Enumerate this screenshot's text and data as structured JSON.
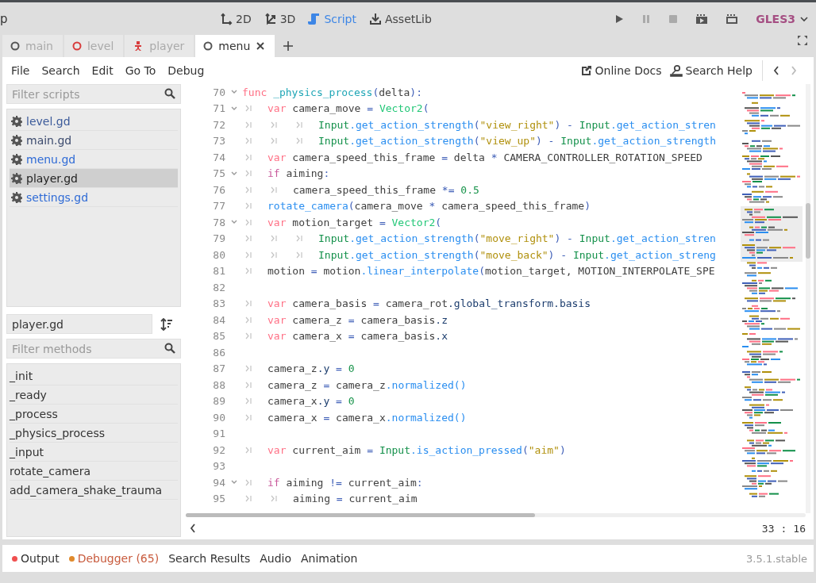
{
  "title_fragment": "p",
  "workspaces": [
    {
      "label": "2D",
      "kind": "flat",
      "selected": false
    },
    {
      "label": "3D",
      "kind": "spatial",
      "selected": false
    },
    {
      "label": "Script",
      "kind": "script",
      "selected": true
    },
    {
      "label": "AssetLib",
      "kind": "assetlib",
      "selected": false
    }
  ],
  "renderer": "GLES3",
  "scene_tabs": [
    {
      "label": "main",
      "kind": "node",
      "selected": false
    },
    {
      "label": "level",
      "kind": "alert",
      "selected": false
    },
    {
      "label": "player",
      "kind": "figure",
      "selected": false
    },
    {
      "label": "menu",
      "kind": "node",
      "selected": true
    }
  ],
  "menu": [
    "File",
    "Search",
    "Edit",
    "Go To",
    "Debug"
  ],
  "help_links": [
    {
      "label": "Online Docs",
      "kind": "external"
    },
    {
      "label": "Search Help",
      "kind": "docsearch"
    }
  ],
  "script_filter": {
    "placeholder": "Filter scripts"
  },
  "scripts": [
    {
      "name": "level.gd",
      "color": "#3b5a9a",
      "selected": false
    },
    {
      "name": "main.gd",
      "color": "#3c4b6e",
      "selected": false
    },
    {
      "name": "menu.gd",
      "color": "#2f6bd6",
      "selected": false
    },
    {
      "name": "player.gd",
      "color": "#1e1e1e",
      "selected": true
    },
    {
      "name": "settings.gd",
      "color": "#2f6bd6",
      "selected": false
    }
  ],
  "current_script": "player.gd",
  "method_filter": {
    "placeholder": "Filter methods"
  },
  "methods": [
    "_init",
    "_ready",
    "_process",
    "_physics_process",
    "_input",
    "rotate_camera",
    "add_camera_shake_trauma"
  ],
  "code": [
    {
      "n": "70",
      "fold": true,
      "tokens": [
        {
          "kind": "kw",
          "t": "func "
        },
        {
          "kind": "fn",
          "t": "_physics_process"
        },
        {
          "kind": "sym",
          "t": "("
        },
        {
          "kind": "txt",
          "t": "delta"
        },
        {
          "kind": "sym",
          "t": "):"
        }
      ]
    },
    {
      "n": "71",
      "fold": true,
      "tokens": [
        {
          "kind": "tab"
        },
        {
          "kind": "kw",
          "t": "var"
        },
        {
          "kind": "txt",
          "t": " camera_move"
        },
        {
          "kind": "sym",
          "t": " = "
        },
        {
          "kind": "ty",
          "t": "Vector2"
        },
        {
          "kind": "sym",
          "t": "("
        }
      ]
    },
    {
      "n": "72",
      "fold": false,
      "tokens": [
        {
          "kind": "tab"
        },
        {
          "kind": "tab"
        },
        {
          "kind": "tab"
        },
        {
          "kind": "cls",
          "t": "Input"
        },
        {
          "kind": "call",
          "t": ".get_action_strength"
        },
        {
          "kind": "sym",
          "t": "("
        },
        {
          "kind": "str",
          "t": "\"view_right\""
        },
        {
          "kind": "sym",
          "t": ") - "
        },
        {
          "kind": "cls",
          "t": "Input"
        },
        {
          "kind": "call",
          "t": ".get_action_stren"
        }
      ]
    },
    {
      "n": "73",
      "fold": false,
      "tokens": [
        {
          "kind": "tab"
        },
        {
          "kind": "tab"
        },
        {
          "kind": "tab"
        },
        {
          "kind": "cls",
          "t": "Input"
        },
        {
          "kind": "call",
          "t": ".get_action_strength"
        },
        {
          "kind": "sym",
          "t": "("
        },
        {
          "kind": "str",
          "t": "\"view_up\""
        },
        {
          "kind": "sym",
          "t": ") - "
        },
        {
          "kind": "cls",
          "t": "Input"
        },
        {
          "kind": "call",
          "t": ".get_action_strength"
        }
      ]
    },
    {
      "n": "74",
      "fold": false,
      "tokens": [
        {
          "kind": "tab"
        },
        {
          "kind": "kw",
          "t": "var"
        },
        {
          "kind": "txt",
          "t": " camera_speed_this_frame"
        },
        {
          "kind": "sym",
          "t": " = "
        },
        {
          "kind": "txt",
          "t": "delta"
        },
        {
          "kind": "sym",
          "t": " * "
        },
        {
          "kind": "txt",
          "t": "CAMERA_CONTROLLER_ROTATION_SPEED"
        }
      ]
    },
    {
      "n": "75",
      "fold": true,
      "tokens": [
        {
          "kind": "tab"
        },
        {
          "kind": "ctrl",
          "t": "if"
        },
        {
          "kind": "txt",
          "t": " aiming"
        },
        {
          "kind": "sym",
          "t": ":"
        }
      ]
    },
    {
      "n": "76",
      "fold": false,
      "tokens": [
        {
          "kind": "tab"
        },
        {
          "kind": "tab"
        },
        {
          "kind": "txt",
          "t": "camera_speed_this_frame"
        },
        {
          "kind": "sym",
          "t": " *= "
        },
        {
          "kind": "num",
          "t": "0.5"
        }
      ]
    },
    {
      "n": "77",
      "fold": false,
      "tokens": [
        {
          "kind": "tab"
        },
        {
          "kind": "call",
          "t": "rotate_camera"
        },
        {
          "kind": "sym",
          "t": "("
        },
        {
          "kind": "txt",
          "t": "camera_move"
        },
        {
          "kind": "sym",
          "t": " * "
        },
        {
          "kind": "txt",
          "t": "camera_speed_this_frame"
        },
        {
          "kind": "sym",
          "t": ")"
        }
      ]
    },
    {
      "n": "78",
      "fold": true,
      "tokens": [
        {
          "kind": "tab"
        },
        {
          "kind": "kw",
          "t": "var"
        },
        {
          "kind": "txt",
          "t": " motion_target"
        },
        {
          "kind": "sym",
          "t": " = "
        },
        {
          "kind": "ty",
          "t": "Vector2"
        },
        {
          "kind": "sym",
          "t": "("
        }
      ]
    },
    {
      "n": "79",
      "fold": false,
      "tokens": [
        {
          "kind": "tab"
        },
        {
          "kind": "tab"
        },
        {
          "kind": "tab"
        },
        {
          "kind": "cls",
          "t": "Input"
        },
        {
          "kind": "call",
          "t": ".get_action_strength"
        },
        {
          "kind": "sym",
          "t": "("
        },
        {
          "kind": "str",
          "t": "\"move_right\""
        },
        {
          "kind": "sym",
          "t": ") - "
        },
        {
          "kind": "cls",
          "t": "Input"
        },
        {
          "kind": "call",
          "t": ".get_action_stren"
        }
      ]
    },
    {
      "n": "80",
      "fold": false,
      "tokens": [
        {
          "kind": "tab"
        },
        {
          "kind": "tab"
        },
        {
          "kind": "tab"
        },
        {
          "kind": "cls",
          "t": "Input"
        },
        {
          "kind": "call",
          "t": ".get_action_strength"
        },
        {
          "kind": "sym",
          "t": "("
        },
        {
          "kind": "str",
          "t": "\"move_back\""
        },
        {
          "kind": "sym",
          "t": ") - "
        },
        {
          "kind": "cls",
          "t": "Input"
        },
        {
          "kind": "call",
          "t": ".get_action_streng"
        }
      ]
    },
    {
      "n": "81",
      "fold": false,
      "tokens": [
        {
          "kind": "tab"
        },
        {
          "kind": "txt",
          "t": "motion"
        },
        {
          "kind": "sym",
          "t": " = "
        },
        {
          "kind": "txt",
          "t": "motion"
        },
        {
          "kind": "call",
          "t": ".linear_interpolate"
        },
        {
          "kind": "sym",
          "t": "("
        },
        {
          "kind": "txt",
          "t": "motion_target, MOTION_INTERPOLATE_SPE"
        }
      ]
    },
    {
      "n": "82",
      "fold": false
    },
    {
      "n": "83",
      "fold": false,
      "tokens": [
        {
          "kind": "tab"
        },
        {
          "kind": "kw",
          "t": "var"
        },
        {
          "kind": "txt",
          "t": " camera_basis"
        },
        {
          "kind": "sym",
          "t": " = "
        },
        {
          "kind": "txt",
          "t": "camera_rot"
        },
        {
          "kind": "prop",
          "t": ".global_transform.basis"
        }
      ]
    },
    {
      "n": "84",
      "fold": false,
      "tokens": [
        {
          "kind": "tab"
        },
        {
          "kind": "kw",
          "t": "var"
        },
        {
          "kind": "txt",
          "t": " camera_z"
        },
        {
          "kind": "sym",
          "t": " = "
        },
        {
          "kind": "txt",
          "t": "camera_basis"
        },
        {
          "kind": "prop",
          "t": ".z"
        }
      ]
    },
    {
      "n": "85",
      "fold": false,
      "tokens": [
        {
          "kind": "tab"
        },
        {
          "kind": "kw",
          "t": "var"
        },
        {
          "kind": "txt",
          "t": " camera_x"
        },
        {
          "kind": "sym",
          "t": " = "
        },
        {
          "kind": "txt",
          "t": "camera_basis"
        },
        {
          "kind": "prop",
          "t": ".x"
        }
      ]
    },
    {
      "n": "86",
      "fold": false
    },
    {
      "n": "87",
      "fold": false,
      "tokens": [
        {
          "kind": "tab"
        },
        {
          "kind": "txt",
          "t": "camera_z"
        },
        {
          "kind": "prop",
          "t": ".y"
        },
        {
          "kind": "sym",
          "t": " = "
        },
        {
          "kind": "num",
          "t": "0"
        }
      ]
    },
    {
      "n": "88",
      "fold": false,
      "tokens": [
        {
          "kind": "tab"
        },
        {
          "kind": "txt",
          "t": "camera_z"
        },
        {
          "kind": "sym",
          "t": " = "
        },
        {
          "kind": "txt",
          "t": "camera_z"
        },
        {
          "kind": "call",
          "t": ".normalized()"
        }
      ]
    },
    {
      "n": "89",
      "fold": false,
      "tokens": [
        {
          "kind": "tab"
        },
        {
          "kind": "txt",
          "t": "camera_x"
        },
        {
          "kind": "prop",
          "t": ".y"
        },
        {
          "kind": "sym",
          "t": " = "
        },
        {
          "kind": "num",
          "t": "0"
        }
      ]
    },
    {
      "n": "90",
      "fold": false,
      "tokens": [
        {
          "kind": "tab"
        },
        {
          "kind": "txt",
          "t": "camera_x"
        },
        {
          "kind": "sym",
          "t": " = "
        },
        {
          "kind": "txt",
          "t": "camera_x"
        },
        {
          "kind": "call",
          "t": ".normalized()"
        }
      ]
    },
    {
      "n": "91",
      "fold": false
    },
    {
      "n": "92",
      "fold": false,
      "tokens": [
        {
          "kind": "tab"
        },
        {
          "kind": "kw",
          "t": "var"
        },
        {
          "kind": "txt",
          "t": " current_aim"
        },
        {
          "kind": "sym",
          "t": " = "
        },
        {
          "kind": "cls",
          "t": "Input"
        },
        {
          "kind": "call",
          "t": ".is_action_pressed"
        },
        {
          "kind": "sym",
          "t": "("
        },
        {
          "kind": "str",
          "t": "\"aim\""
        },
        {
          "kind": "sym",
          "t": ")"
        }
      ]
    },
    {
      "n": "93",
      "fold": false
    },
    {
      "n": "94",
      "fold": true,
      "tokens": [
        {
          "kind": "tab"
        },
        {
          "kind": "ctrl",
          "t": "if"
        },
        {
          "kind": "txt",
          "t": " aiming"
        },
        {
          "kind": "sym",
          "t": " != "
        },
        {
          "kind": "txt",
          "t": "current_aim"
        },
        {
          "kind": "sym",
          "t": ":"
        }
      ]
    },
    {
      "n": "95",
      "fold": false,
      "tokens": [
        {
          "kind": "tab"
        },
        {
          "kind": "tab"
        },
        {
          "kind": "txt",
          "t": "aiming"
        },
        {
          "kind": "sym",
          "t": " = "
        },
        {
          "kind": "txt",
          "t": "current_aim"
        }
      ]
    }
  ],
  "cursor": {
    "line": "33",
    "separator": ":",
    "column": "16"
  },
  "bottom_tabs": [
    {
      "label": "Output",
      "color": "#f05050",
      "alert": false
    },
    {
      "label": "Debugger (65)",
      "color": "#e08a2c",
      "alert": true
    },
    {
      "label": "Search Results",
      "alert": false
    },
    {
      "label": "Audio",
      "alert": false
    },
    {
      "label": "Animation",
      "alert": false
    }
  ],
  "version": "3.5.1.stable"
}
